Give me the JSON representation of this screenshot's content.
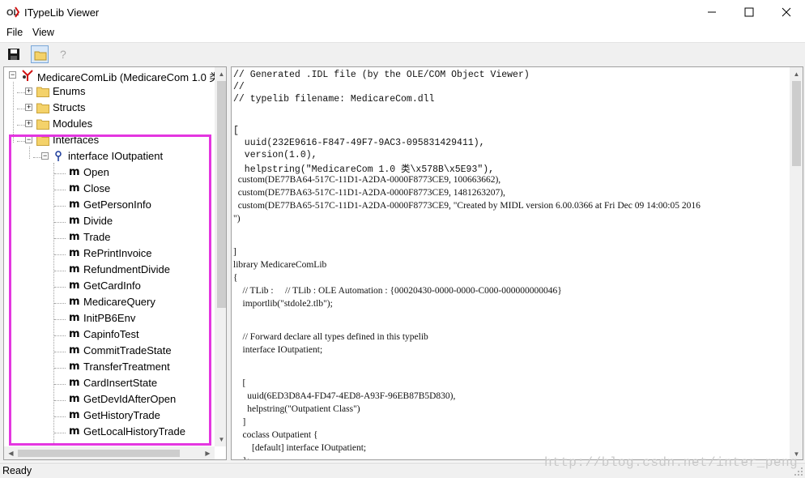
{
  "window": {
    "title": "ITypeLib Viewer",
    "app_icon": "ole-view-icon",
    "controls": [
      "minimize-icon",
      "maximize-icon",
      "close-icon"
    ]
  },
  "menu": {
    "file": "File",
    "view": "View"
  },
  "toolbar": {
    "buttons": [
      "save-icon",
      "folder-open-icon",
      "help-icon"
    ]
  },
  "tree": {
    "root": "MedicareComLib (MedicareCom 1.0 类",
    "folders": {
      "enums": "Enums",
      "structs": "Structs",
      "modules": "Modules",
      "interfaces": "Interfaces"
    },
    "interface": "interface IOutpatient",
    "method_glyph": "m",
    "methods": [
      "Open",
      "Close",
      "GetPersonInfo",
      "Divide",
      "Trade",
      "RePrintInvoice",
      "RefundmentDivide",
      "GetCardInfo",
      "MedicareQuery",
      "InitPB6Env",
      "CapinfoTest",
      "CommitTradeState",
      "TransferTreatment",
      "CardInsertState",
      "GetDevIdAfterOpen",
      "GetHistoryTrade",
      "GetLocalHistoryTrade"
    ],
    "expander_minus": "−",
    "expander_plus": "+"
  },
  "idl": {
    "lines": [
      "// Generated .IDL file (by the OLE/COM Object Viewer)",
      "//",
      "// typelib filename: MedicareCom.dll",
      "",
      "[",
      "  uuid(232E9616-F847-49F7-9AC3-095831429411),",
      "  version(1.0),",
      "  helpstring(\"MedicareCom 1.0 类\\x578B\\x5E93\"),",
      "  custom(DE77BA64-517C-11D1-A2DA-0000F8773CE9, 100663662),",
      "  custom(DE77BA63-517C-11D1-A2DA-0000F8773CE9, 1481263207),",
      "  custom(DE77BA65-517C-11D1-A2DA-0000F8773CE9, \"Created by MIDL version 6.00.0366 at Fri Dec 09 14:00:05 2016",
      "\")",
      "",
      "]",
      "library MedicareComLib",
      "{",
      "    // TLib :     // TLib : OLE Automation : {00020430-0000-0000-C000-000000000046}",
      "    importlib(\"stdole2.tlb\");",
      "",
      "    // Forward declare all types defined in this typelib",
      "    interface IOutpatient;",
      "",
      "    [",
      "      uuid(6ED3D8A4-FD47-4ED8-A93F-96EB87B5D830),",
      "      helpstring(\"Outpatient Class\")",
      "    ]",
      "    coclass Outpatient {",
      "        [default] interface IOutpatient;",
      "    };",
      "",
      "    ["
    ]
  },
  "status": {
    "text": "Ready"
  },
  "watermark": "http://blog.csdn.net/inter_peng",
  "colors": {
    "highlight": "#e436e0",
    "background": "#f0f0f0"
  }
}
